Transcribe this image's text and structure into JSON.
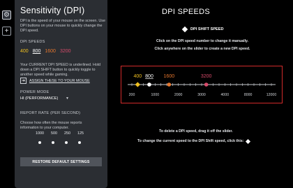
{
  "panel": {
    "title": "Sensitivity (DPI)",
    "description": "DPI is the speed of your mouse on the screen. Use DPI buttons on your mouse to quickly change the DPI speed.",
    "dpi_speeds_label": "DPI SPEEDS",
    "speeds": [
      {
        "label": "400",
        "color": "#f0c020",
        "current": false
      },
      {
        "label": "800",
        "color": "#ffffff",
        "current": true
      },
      {
        "label": "1600",
        "color": "#e6772e",
        "current": false
      },
      {
        "label": "3200",
        "color": "#d84b6b",
        "current": false
      }
    ],
    "current_note": "Your CURRENT DPI SPEED is underlined. Hold down a DPI SHIFT button to quickly toggle to another speed while gaming.",
    "assign_label": "ASSIGN THESE TO YOUR MOUSE",
    "power_mode_label": "POWER MODE",
    "power_mode_value": "HI (PERFORMANCE)",
    "report_rate_label": "REPORT RATE (PER SECOND)",
    "report_rate_desc": "Choose how often the mouse reports information to your computer.",
    "report_rates": [
      "1000",
      "500",
      "250",
      "125"
    ],
    "restore_label": "RESTORE DEFAULT SETTINGS"
  },
  "main": {
    "title": "DPI SPEEDS",
    "shift_label": "DPI SHIFT SPEED",
    "instruction_1": "Click on the DPI speed number to change it manually.",
    "instruction_2": "Click anywhere on the slider to create a new DPI speed.",
    "footer_1": "To delete a DPI speed, drag it off the slider.",
    "footer_2": "To change the current speed to the DPI Shift speed, click this:"
  },
  "slider": {
    "tick_labels": [
      "200",
      "1000",
      "2000",
      "3000",
      "4000",
      "8000",
      "12000"
    ],
    "points": [
      {
        "label": "400",
        "color": "#f0c020",
        "shape": "diamond"
      },
      {
        "label": "800",
        "color": "#ffffff",
        "shape": "circle"
      },
      {
        "label": "1600",
        "color": "#e6772e",
        "shape": "circle"
      },
      {
        "label": "3200",
        "color": "#d84b6b",
        "shape": "circle"
      }
    ]
  }
}
